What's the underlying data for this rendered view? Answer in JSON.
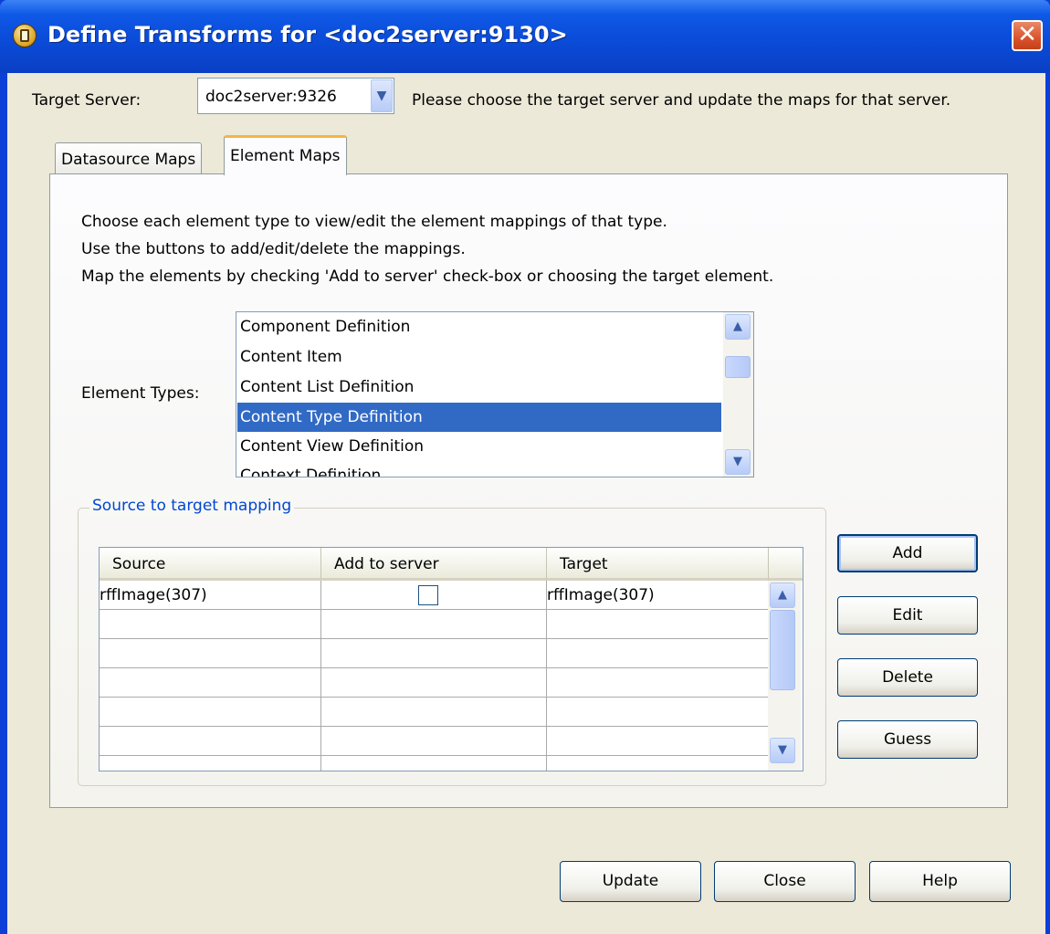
{
  "window": {
    "title": "Define Transforms for <doc2server:9130>"
  },
  "target_server": {
    "label": "Target Server:",
    "value": "doc2server:9326",
    "hint": "Please choose the target server and update the maps for that server."
  },
  "tabs": [
    {
      "label": "Datasource Maps",
      "active": false
    },
    {
      "label": "Element Maps",
      "active": true
    }
  ],
  "instructions": [
    "Choose each element type to view/edit the element mappings of that type.",
    "Use the buttons to add/edit/delete the mappings.",
    "Map the elements by checking 'Add to server' check-box or choosing the target element."
  ],
  "element_types": {
    "label": "Element Types:",
    "items": [
      "Component Definition",
      "Content Item",
      "Content List Definition",
      "Content Type Definition",
      "Content View Definition",
      "Context Definition"
    ],
    "selected": "Content Type Definition"
  },
  "mapping": {
    "title": "Source to target mapping",
    "columns": [
      "Source",
      "Add to server",
      "Target"
    ],
    "rows": [
      {
        "source": "rffImage(307)",
        "add_to_server": false,
        "target": "rffImage(307)"
      }
    ]
  },
  "side_buttons": {
    "add": "Add",
    "edit": "Edit",
    "delete": "Delete",
    "guess": "Guess"
  },
  "footer_buttons": {
    "update": "Update",
    "close": "Close",
    "help": "Help"
  },
  "icons": {
    "app": "app-icon",
    "close": "close-icon",
    "dropdown": "chevron-down-icon",
    "scroll_up": "chevron-up-icon",
    "scroll_down": "chevron-down-icon"
  },
  "colors": {
    "titlebar": "#0a4ad6",
    "dialog_bg": "#ece9d8",
    "selection": "#316ac5",
    "active_tab_accent": "#f5b543",
    "group_title": "#0046d5"
  }
}
